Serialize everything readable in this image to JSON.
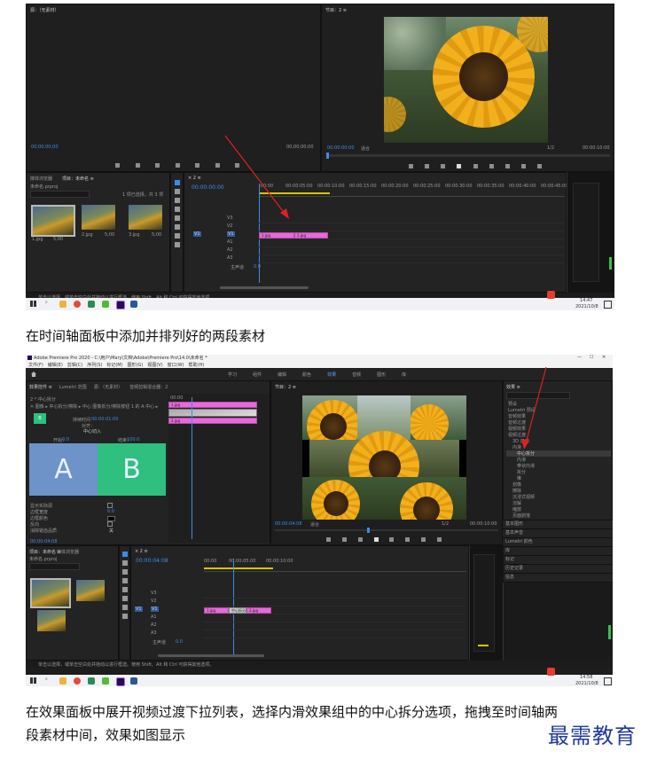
{
  "screenshot1": {
    "source_monitor_title": "源：（无素材）",
    "program_title": "节目：2 ≡",
    "source_timecode_left": "00;00;00;00",
    "source_timecode_right": "00;00;00;00",
    "program_timecode": "00:00:00:00",
    "program_fit": "适合",
    "program_quality": "1/2",
    "program_duration": "00:00:10:00",
    "project_tabs": [
      "媒体浏览器",
      "项目：未命名 ≡"
    ],
    "project_search": "未命名.prproj",
    "project_items_count": "1 项已选择，共 3 项",
    "thumb_labels": [
      "1.jpg",
      "2.jpg",
      "3.jpg"
    ],
    "thumb_durations": [
      "5;00",
      "5;00",
      "5;00"
    ],
    "sequence_tab": "× 2 ≡",
    "timeline_timecode": "00:00:00:00",
    "ruler_labels": [
      ":00:00",
      "00:00:05:00",
      "00:00:10:00",
      "00:00:15:00",
      "00:00:20:00",
      "00:00:25:00",
      "00:00:30:00",
      "00:00:35:00",
      "00:00:40:00",
      "00:00:45:00"
    ],
    "tracks": [
      "V3",
      "V2",
      "V1",
      "A1",
      "A2",
      "A3",
      "主声道"
    ],
    "clips": [
      "1.jpg",
      "2.jpg"
    ],
    "master_value": "0.0",
    "status_text": "单击以选择，或单击空白处并拖动以进行框选。使用 Shift、Alt 和 Ctrl 可获得其他选项。",
    "taskbar_time": "14:47",
    "taskbar_date": "2021/10/8"
  },
  "caption1": "在时间轴面板中添加并排列好的两段素材",
  "screenshot2": {
    "app_title": "Adobe Premiere Pro 2020 - C:\\用户\\Mary\\文档\\Adobe\\Premiere Pro\\14.0\\未命名 *",
    "menu": [
      "文件(F)",
      "编辑(E)",
      "剪辑(C)",
      "序列(S)",
      "标记(M)",
      "图形(G)",
      "视图(V)",
      "窗口(W)",
      "帮助(H)"
    ],
    "workspace_tabs": [
      "学习",
      "组件",
      "编辑",
      "颜色",
      "效果",
      "音频",
      "图形",
      "库"
    ],
    "active_workspace": "效果",
    "left_tabs": [
      "效果控件 ≡",
      "Lumetri 范围",
      "源：（无素材）",
      "音频剪辑混合器：2"
    ],
    "effect_title": "2 * 中心拆分",
    "effect_path": "✕ 图像 ▸ 中心拆分/擦除 ▸ 中心 图像拆分/擦除按钮 1 的 A 中心 ▸",
    "duration_label": "持续时间",
    "duration_value": "00:00:01:00",
    "alignment_label": "对齐：",
    "alignment_value": "中心切入",
    "start_label": "开始：",
    "start_value": "0.0",
    "end_label": "结束：",
    "end_value": "100.0",
    "letters": [
      "A",
      "B"
    ],
    "options": [
      "显示实际源",
      "边框宽度",
      "边框颜色",
      "反向",
      "消除锯齿品质"
    ],
    "antialias_value": "关",
    "border_width_value": "0.0",
    "ec_timecode": "00:00:04:08",
    "ec_clips": [
      "1.jpg",
      "中心拆分",
      "2.jpg"
    ],
    "program_title": "节目：2 ≡",
    "program_timecode": "00:00:04:08",
    "program_fit": "适合",
    "program_quality": "1/2",
    "program_duration": "00:00:10:00",
    "effects_panel_title": "效果 ≡",
    "effects_tree": [
      "预设",
      "Lumetri 预设",
      "音频效果",
      "音频过渡",
      "视频效果",
      "视频过渡",
      "3D 运动",
      "内滑",
      "中心拆分",
      "内滑",
      "带状内滑",
      "拆分",
      "推",
      "划像",
      "擦除",
      "沉浸式视频",
      "溶解",
      "缩放",
      "页面剥落"
    ],
    "right_panels": [
      "基本图形",
      "基本声音",
      "Lumetri 颜色",
      "库",
      "标记",
      "历史记录",
      "信息"
    ],
    "project_tabs": [
      "项目：未命名 ≡",
      "媒体浏览器"
    ],
    "project_search": "未命名.prproj",
    "sequence_tab": "× 2 ≡",
    "timeline_timecode": "00:00:04:08",
    "ruler_labels": [
      "00:00",
      "00:00:05:00",
      "00:00:10:00"
    ],
    "clips": [
      "1.jpg",
      "中心拆分",
      "2.jpg"
    ],
    "tracks": [
      "V3",
      "V2",
      "V1",
      "A1",
      "A2",
      "A3",
      "主声道"
    ],
    "master_value": "0.0",
    "status_text": "单击以选择，或单击空白处并拖动以进行框选。使用 Shift、Alt 和 Ctrl 可获得其他选项。",
    "taskbar_time": "14:58",
    "taskbar_date": "2021/10/8"
  },
  "caption2_line1": "在效果面板中展开视频过渡下拉列表，选择内滑效果组中的中心拆分选项，拖拽至时间轴两",
  "caption2_line2": "段素材中间，效果如图显示",
  "watermark": "最需教育",
  "colors": {
    "clip_pink": "#e46bd8",
    "accent_blue": "#3c8ce7",
    "arrow_red": "#e02020",
    "panel_dark": "#232323",
    "watermark_blue": "#1f3a9e"
  }
}
